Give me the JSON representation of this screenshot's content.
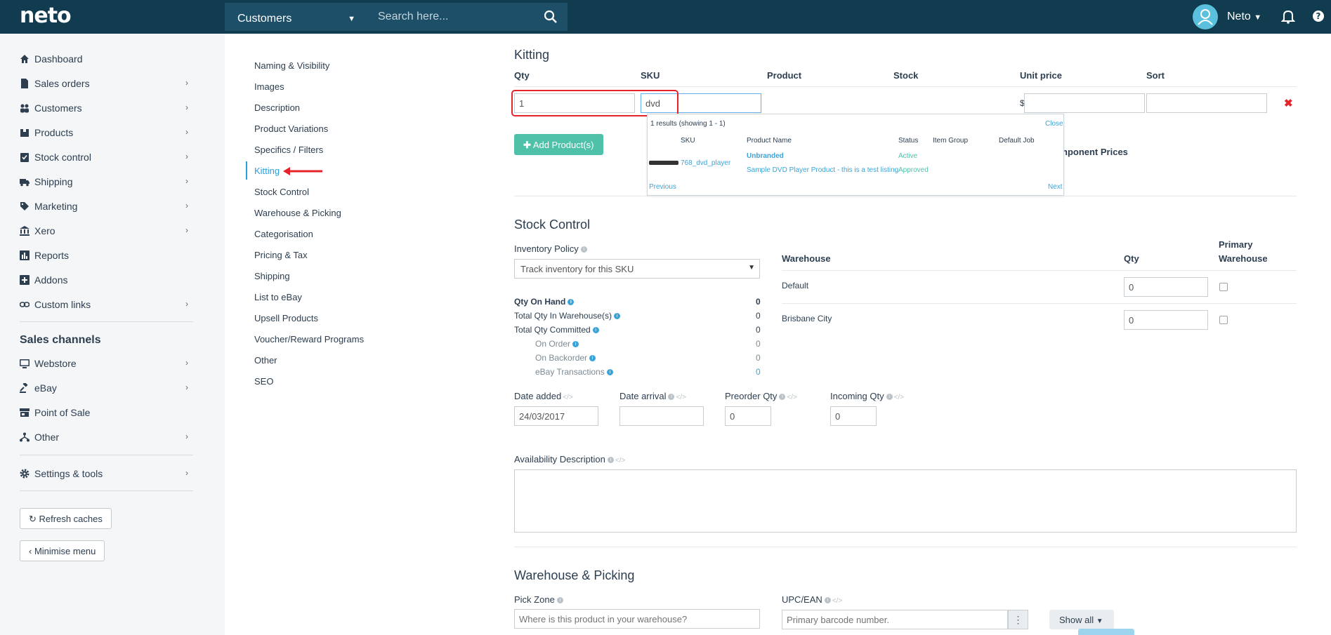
{
  "app": {
    "logo": "neto",
    "module": "Customers",
    "search_placeholder": "Search here...",
    "user": "Neto"
  },
  "sidebar": {
    "items": [
      {
        "label": "Dashboard",
        "icon": "home-icon"
      },
      {
        "label": "Sales orders",
        "icon": "document-icon"
      },
      {
        "label": "Customers",
        "icon": "users-icon"
      },
      {
        "label": "Products",
        "icon": "box-icon"
      },
      {
        "label": "Stock control",
        "icon": "clipboard-check-icon"
      },
      {
        "label": "Shipping",
        "icon": "truck-icon"
      },
      {
        "label": "Marketing",
        "icon": "tag-icon"
      },
      {
        "label": "Xero",
        "icon": "bank-icon"
      },
      {
        "label": "Reports",
        "icon": "bar-chart-icon"
      },
      {
        "label": "Addons",
        "icon": "plus-square-icon"
      },
      {
        "label": "Custom links",
        "icon": "link-icon"
      }
    ],
    "channels_title": "Sales channels",
    "channels": [
      {
        "label": "Webstore",
        "icon": "monitor-icon"
      },
      {
        "label": "eBay",
        "icon": "gavel-icon"
      },
      {
        "label": "Point of Sale",
        "icon": "store-icon"
      },
      {
        "label": "Other",
        "icon": "sitemap-icon"
      }
    ],
    "settings": "Settings & tools",
    "refresh": "Refresh caches",
    "minimise": "Minimise menu"
  },
  "subnav": [
    "Naming & Visibility",
    "Images",
    "Description",
    "Product Variations",
    "Specifics / Filters",
    "Kitting",
    "Stock Control",
    "Warehouse & Picking",
    "Categorisation",
    "Pricing & Tax",
    "Shipping",
    "List to eBay",
    "Upsell Products",
    "Voucher/Reward Programs",
    "Other",
    "SEO"
  ],
  "kitting": {
    "title": "Kitting",
    "headers": [
      "Qty",
      "SKU",
      "Product",
      "Stock",
      "Unit price",
      "Sort"
    ],
    "qty": "1",
    "sku": "dvd",
    "currency": "$",
    "add_button": "Add Product(s)",
    "component_prices": "nponent Prices",
    "dropdown": {
      "summary": "1 results (showing 1 - 1)",
      "close": "Close",
      "headers": [
        "SKU",
        "Product Name",
        "Status",
        "Item Group",
        "Default Job"
      ],
      "sku": "768_dvd_player",
      "product": "Unbranded",
      "product_sub": "Sample DVD Player Product - this is a test listing",
      "status": "Active",
      "status_sub": "Approved",
      "prev": "Previous",
      "next": "Next"
    }
  },
  "stock": {
    "title": "Stock Control",
    "inventory_label": "Inventory Policy",
    "inventory_value": "Track inventory for this SKU",
    "rows": [
      {
        "label": "Qty On Hand",
        "value": "0"
      },
      {
        "label": "Total Qty In Warehouse(s)",
        "value": "0"
      },
      {
        "label": "Total Qty Committed",
        "value": "0"
      },
      {
        "label": "On Order",
        "value": "0"
      },
      {
        "label": "On Backorder",
        "value": "0"
      },
      {
        "label": "eBay Transactions",
        "value": "0"
      }
    ],
    "wh_headers": {
      "warehouse": "Warehouse",
      "qty": "Qty",
      "primary": "Primary",
      "primary2": "Warehouse"
    },
    "warehouses": [
      {
        "name": "Default",
        "qty": "0"
      },
      {
        "name": "Brisbane City",
        "qty": "0"
      }
    ],
    "date_added": "Date added",
    "date_added_value": "24/03/2017",
    "date_arrival": "Date arrival",
    "preorder": "Preorder Qty",
    "preorder_value": "0",
    "incoming": "Incoming Qty",
    "incoming_value": "0",
    "availability": "Availability Description"
  },
  "warehouse_picking": {
    "title": "Warehouse & Picking",
    "pick_zone": "Pick Zone",
    "pick_placeholder": "Where is this product in your warehouse?",
    "upc": "UPC/EAN",
    "upc_placeholder": "Primary barcode number.",
    "show_all": "Show all"
  },
  "colors": {
    "topbar": "#113c4f",
    "accent": "#2b9fd9",
    "green_button": "#4fc1a9",
    "highlight": "#e5232b"
  }
}
